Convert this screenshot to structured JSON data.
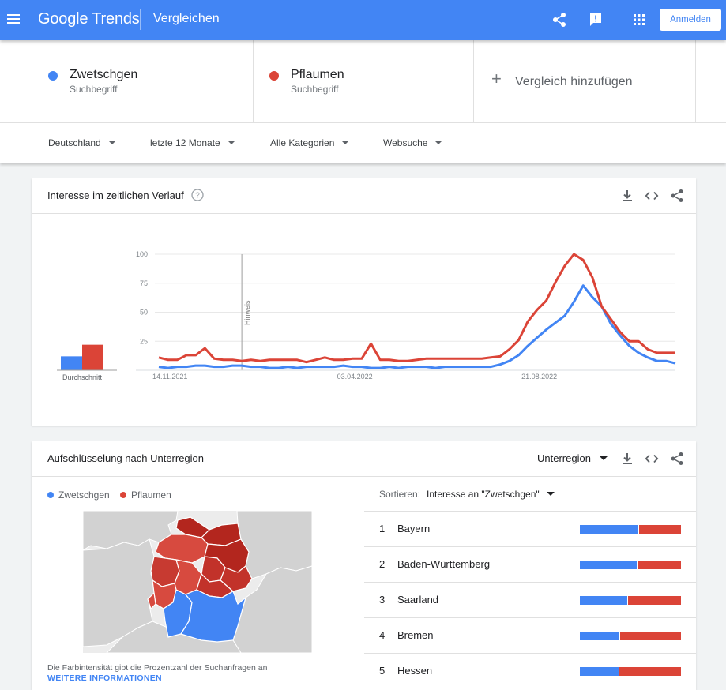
{
  "header": {
    "logo": "Google Trends",
    "title": "Vergleichen",
    "signin_label": "Anmelden",
    "icons": [
      "menu-icon",
      "share-icon",
      "feedback-icon",
      "apps-icon"
    ]
  },
  "terms": [
    {
      "name": "Zwetschgen",
      "type": "Suchbegriff",
      "color": "#4285f4"
    },
    {
      "name": "Pflaumen",
      "type": "Suchbegriff",
      "color": "#db4437"
    }
  ],
  "add_compare": "Vergleich hinzufügen",
  "filters": {
    "region": "Deutschland",
    "time": "letzte 12 Monate",
    "category": "Alle Kategorien",
    "search_type": "Websuche"
  },
  "interest_over_time": {
    "title": "Interesse im zeitlichen Verlauf",
    "avg_label": "Durchschnitt",
    "note_label": "Hinweis"
  },
  "chart_data": {
    "type": "line",
    "title": "Interesse im zeitlichen Verlauf",
    "x_tick_labels": [
      "14.11.2021",
      "03.04.2022",
      "21.08.2022"
    ],
    "y_ticks": [
      25,
      50,
      75,
      100
    ],
    "ylim": [
      0,
      100
    ],
    "grid": true,
    "annotation": {
      "label": "Hinweis",
      "week_index": 9
    },
    "series": [
      {
        "name": "Zwetschgen",
        "color": "#4285f4",
        "average": 12,
        "values": [
          3,
          2,
          3,
          3,
          4,
          4,
          3,
          3,
          4,
          4,
          3,
          3,
          2,
          2,
          3,
          2,
          3,
          3,
          3,
          3,
          4,
          3,
          3,
          2,
          2,
          3,
          2,
          3,
          3,
          3,
          2,
          3,
          3,
          3,
          3,
          3,
          3,
          5,
          8,
          13,
          21,
          28,
          35,
          41,
          47,
          59,
          73,
          63,
          55,
          40,
          30,
          21,
          15,
          11,
          8,
          8,
          6
        ]
      },
      {
        "name": "Pflaumen",
        "color": "#db4437",
        "average": 22,
        "values": [
          11,
          9,
          9,
          13,
          13,
          19,
          10,
          9,
          9,
          8,
          9,
          8,
          9,
          9,
          9,
          9,
          7,
          9,
          11,
          9,
          9,
          10,
          10,
          23,
          9,
          9,
          8,
          8,
          9,
          10,
          10,
          10,
          10,
          10,
          10,
          10,
          11,
          12,
          18,
          26,
          42,
          52,
          60,
          76,
          90,
          100,
          95,
          80,
          55,
          44,
          33,
          25,
          25,
          18,
          15,
          15,
          15
        ]
      }
    ]
  },
  "subregion": {
    "title": "Aufschlüsselung nach Unterregion",
    "selector": "Unterregion",
    "legend": [
      "Zwetschgen",
      "Pflaumen"
    ],
    "sort_label": "Sortieren:",
    "sort_value": "Interesse an \"Zwetschgen\"",
    "map_note": "Die Farbintensität gibt die Prozentzahl der Suchanfragen an",
    "map_more": "WEITERE INFORMATIONEN",
    "rows": [
      {
        "rank": "1",
        "name": "Bayern",
        "zwetschgen_share": 0.58
      },
      {
        "rank": "2",
        "name": "Baden-Württemberg",
        "zwetschgen_share": 0.56
      },
      {
        "rank": "3",
        "name": "Saarland",
        "zwetschgen_share": 0.47
      },
      {
        "rank": "4",
        "name": "Bremen",
        "zwetschgen_share": 0.39
      },
      {
        "rank": "5",
        "name": "Hessen",
        "zwetschgen_share": 0.38
      }
    ]
  }
}
